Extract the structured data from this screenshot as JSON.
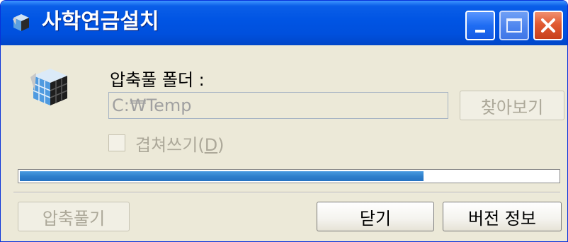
{
  "window": {
    "title": "사학연금설치",
    "buttons": {
      "minimize": "minimize-icon",
      "maximize": "maximize-icon",
      "close": "close-icon"
    }
  },
  "form": {
    "folder_label": "압축풀 폴더 :",
    "folder_value": "C:₩Temp",
    "browse_label": "찾아보기",
    "overwrite_label": "겹쳐쓰기(",
    "overwrite_hotkey": "D",
    "overwrite_suffix": ")",
    "overwrite_checked": false
  },
  "progress": {
    "fraction": 0.75,
    "color": "#2f80cc"
  },
  "footer": {
    "extract_label": "압축풀기",
    "close_label": "닫기",
    "version_label": "버전 정보"
  },
  "colors": {
    "titlebar": "#0054e3",
    "face": "#ece9d8",
    "close_button": "#e15a32"
  }
}
